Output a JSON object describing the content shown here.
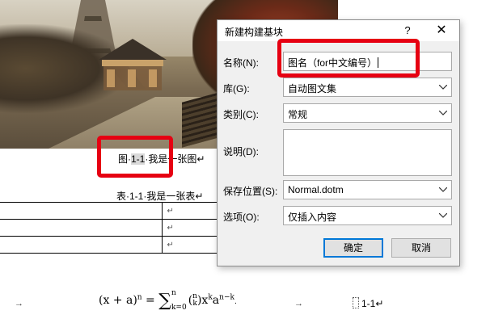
{
  "document": {
    "figure_caption_label": "图·",
    "figure_caption_number": "1-1",
    "figure_caption_text": "·我是一张图↵",
    "table_caption": "表·1-1·我是一张表↵",
    "table_rows": [
      {
        "c1": "",
        "c2": "↵"
      },
      {
        "c1": "",
        "c2": "↵"
      },
      {
        "c1": "",
        "c2": "↵"
      }
    ],
    "formula": {
      "left_arrow": "→",
      "lhs": "(x + a)",
      "lhs_exp": "n",
      "eq": " = ",
      "sum_top": "n",
      "sum_bottom": "k=0",
      "binom_top": "n",
      "binom_bottom": "k",
      "term": "x",
      "term_exp": "k",
      "term2": "a",
      "term2_exp": "n−k",
      "end": ".",
      "right_arrow": "→",
      "number": "1-1↵"
    }
  },
  "dialog": {
    "title": "新建构建基块",
    "help_label": "?",
    "close_label": "✕",
    "fields": {
      "name_label": "名称(N):",
      "name_value": "图名（for中文编号）",
      "gallery_label": "库(G):",
      "gallery_value": "自动图文集",
      "category_label": "类别(C):",
      "category_value": "常规",
      "description_label": "说明(D):",
      "description_value": "",
      "save_in_label": "保存位置(S):",
      "save_in_value": "Normal.dotm",
      "options_label": "选项(O):",
      "options_value": "仅插入内容"
    },
    "ok_label": "确定",
    "cancel_label": "取消"
  },
  "colors": {
    "highlight": "#e60012",
    "dialog_bg": "#f0f0f0",
    "primary_border": "#0078d7"
  }
}
